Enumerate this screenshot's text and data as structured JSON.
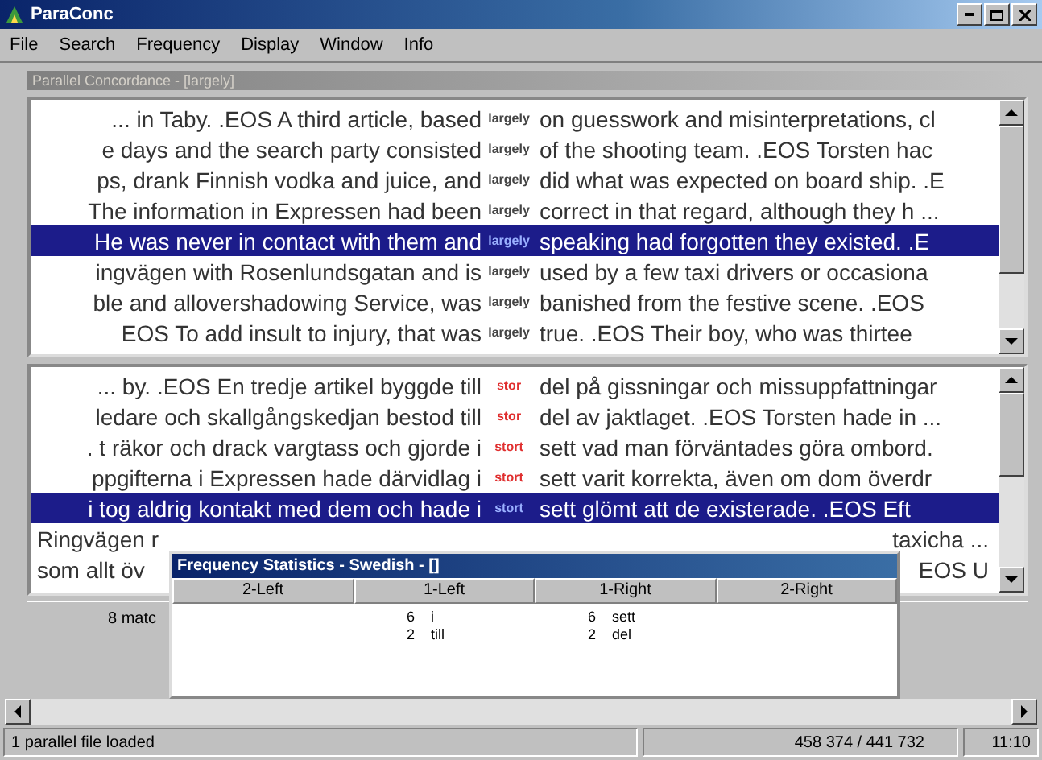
{
  "window": {
    "title": "ParaConc"
  },
  "menu": [
    "File",
    "Search",
    "Frequency",
    "Display",
    "Window",
    "Info"
  ],
  "child_window": {
    "title": "Parallel Concordance - [largely]"
  },
  "panes": [
    {
      "rows": [
        {
          "kind": "full",
          "left": "... in Taby. .EOS  A third article, based",
          "keyword": "largely",
          "right": "on guesswork and misinterpretations, cl",
          "selected": false
        },
        {
          "kind": "full",
          "left": "e days and the search party consisted",
          "keyword": "largely",
          "right": "of the shooting team. .EOS Torsten hac",
          "selected": false
        },
        {
          "kind": "full",
          "left": "ps, drank Finnish vodka and juice, and",
          "keyword": "largely",
          "right": "did what was expected on board ship. .E",
          "selected": false
        },
        {
          "kind": "full",
          "left": "The information in Expressen had been",
          "keyword": "largely",
          "right": "correct in that regard, although they h ...",
          "selected": false
        },
        {
          "kind": "full",
          "left": "He was never in contact with them and",
          "keyword": "largely",
          "right": "speaking had forgotten they existed. .E",
          "selected": true
        },
        {
          "kind": "full",
          "left": "ingvägen with Rosenlundsgatan and is",
          "keyword": "largely",
          "right": "used by a few taxi drivers or occasiona",
          "selected": false
        },
        {
          "kind": "full",
          "left": "ble and allovershadowing Service, was",
          "keyword": "largely",
          "right": "banished from the festive scene. .EOS",
          "selected": false
        },
        {
          "kind": "full",
          "left": "EOS To add insult to injury, that was",
          "keyword": "largely",
          "right": "true. .EOS  Their boy, who was thirtee",
          "selected": false
        }
      ]
    },
    {
      "rows": [
        {
          "kind": "full",
          "left": "... by. .EOS En tredje artikel byggde till",
          "keyword": "stor",
          "right": "del på gissningar och missuppfattningar",
          "selected": false
        },
        {
          "kind": "full",
          "left": "ledare och skallgångskedjan bestod till",
          "keyword": "stor",
          "right": "del av jaktlaget. .EOS Torsten hade in ...",
          "selected": false
        },
        {
          "kind": "full",
          "left": ". t räkor och drack vargtass och gjorde i",
          "keyword": "stort",
          "right": "sett vad man förväntades göra ombord.",
          "selected": false
        },
        {
          "kind": "full",
          "left": "ppgifterna i Expressen hade därvidlag i",
          "keyword": "stort",
          "right": "sett varit korrekta, även om dom överdr",
          "selected": false
        },
        {
          "kind": "full",
          "left": "i tog aldrig kontakt med dem och hade i",
          "keyword": "stort",
          "right": "sett glömt att de existerade. .EOS Eft",
          "selected": true
        },
        {
          "kind": "partial",
          "left": "Ringvägen r",
          "right": "taxicha ..."
        },
        {
          "kind": "partial",
          "left": "som allt öv",
          "right": "EOS U"
        }
      ]
    }
  ],
  "match_count": "8 matc",
  "frequency_window": {
    "title": "Frequency Statistics - Swedish - []",
    "columns": [
      "2-Left",
      "1-Left",
      "1-Right",
      "2-Right"
    ],
    "rows": [
      {
        "left_count": "6",
        "left_word": "i",
        "right_count": "6",
        "right_word": "sett"
      },
      {
        "left_count": "2",
        "left_word": "till",
        "right_count": "2",
        "right_word": "del"
      }
    ]
  },
  "status_bar": [
    "1 parallel file loaded",
    "458 374 / 441 732",
    "11:10"
  ]
}
